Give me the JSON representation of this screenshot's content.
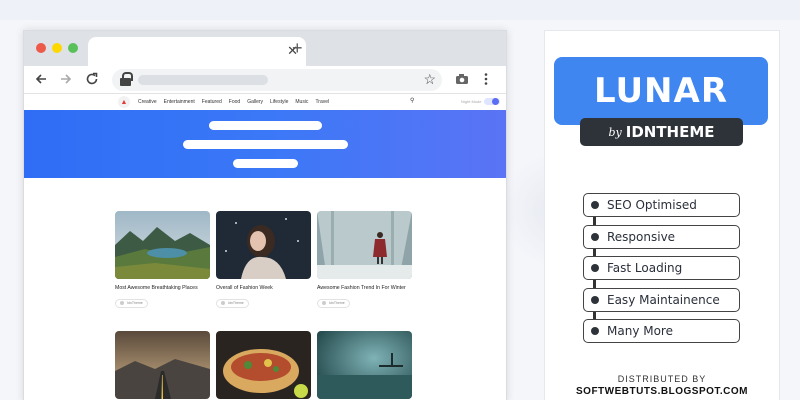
{
  "colors": {
    "hero_blue": "#3478f6",
    "lunar_blue": "#3f86f1",
    "dark": "#2e3339"
  },
  "browser": {
    "tab_close_icon": "close-icon",
    "new_tab_icon": "plus-icon",
    "nav": {
      "back_icon": "arrow-left-icon",
      "forward_icon": "arrow-right-icon",
      "reload_icon": "reload-icon",
      "bookmark_icon": "star-icon",
      "camera_icon": "camera-icon",
      "menu_icon": "kebab-menu-icon"
    }
  },
  "site": {
    "menu": [
      "Creative",
      "Entertainment",
      "Featured",
      "Food",
      "Gallery",
      "Lifestyle",
      "Music",
      "Travel"
    ],
    "night_mode_label": "Night Mode",
    "posts": [
      {
        "title": "Most Awesome Breathtaking Places",
        "author": "IdnTheme"
      },
      {
        "title": "Overall of Fashion Week",
        "author": "IdnTheme"
      },
      {
        "title": "Awesome Fashion Trend In For Winter",
        "author": "IdnTheme"
      },
      {
        "title": "",
        "author": ""
      },
      {
        "title": "",
        "author": ""
      },
      {
        "title": "",
        "author": ""
      }
    ]
  },
  "promo": {
    "title": "LUNAR",
    "by": "by",
    "brand": "IDNTHEME",
    "features": [
      "SEO Optimised",
      "Responsive",
      "Fast Loading",
      "Easy Maintainence",
      "Many More"
    ],
    "distributed_label": "DISTRIBUTED BY",
    "distributed_site": "SOFTWEBTUTS.BLOGSPOT.COM"
  }
}
